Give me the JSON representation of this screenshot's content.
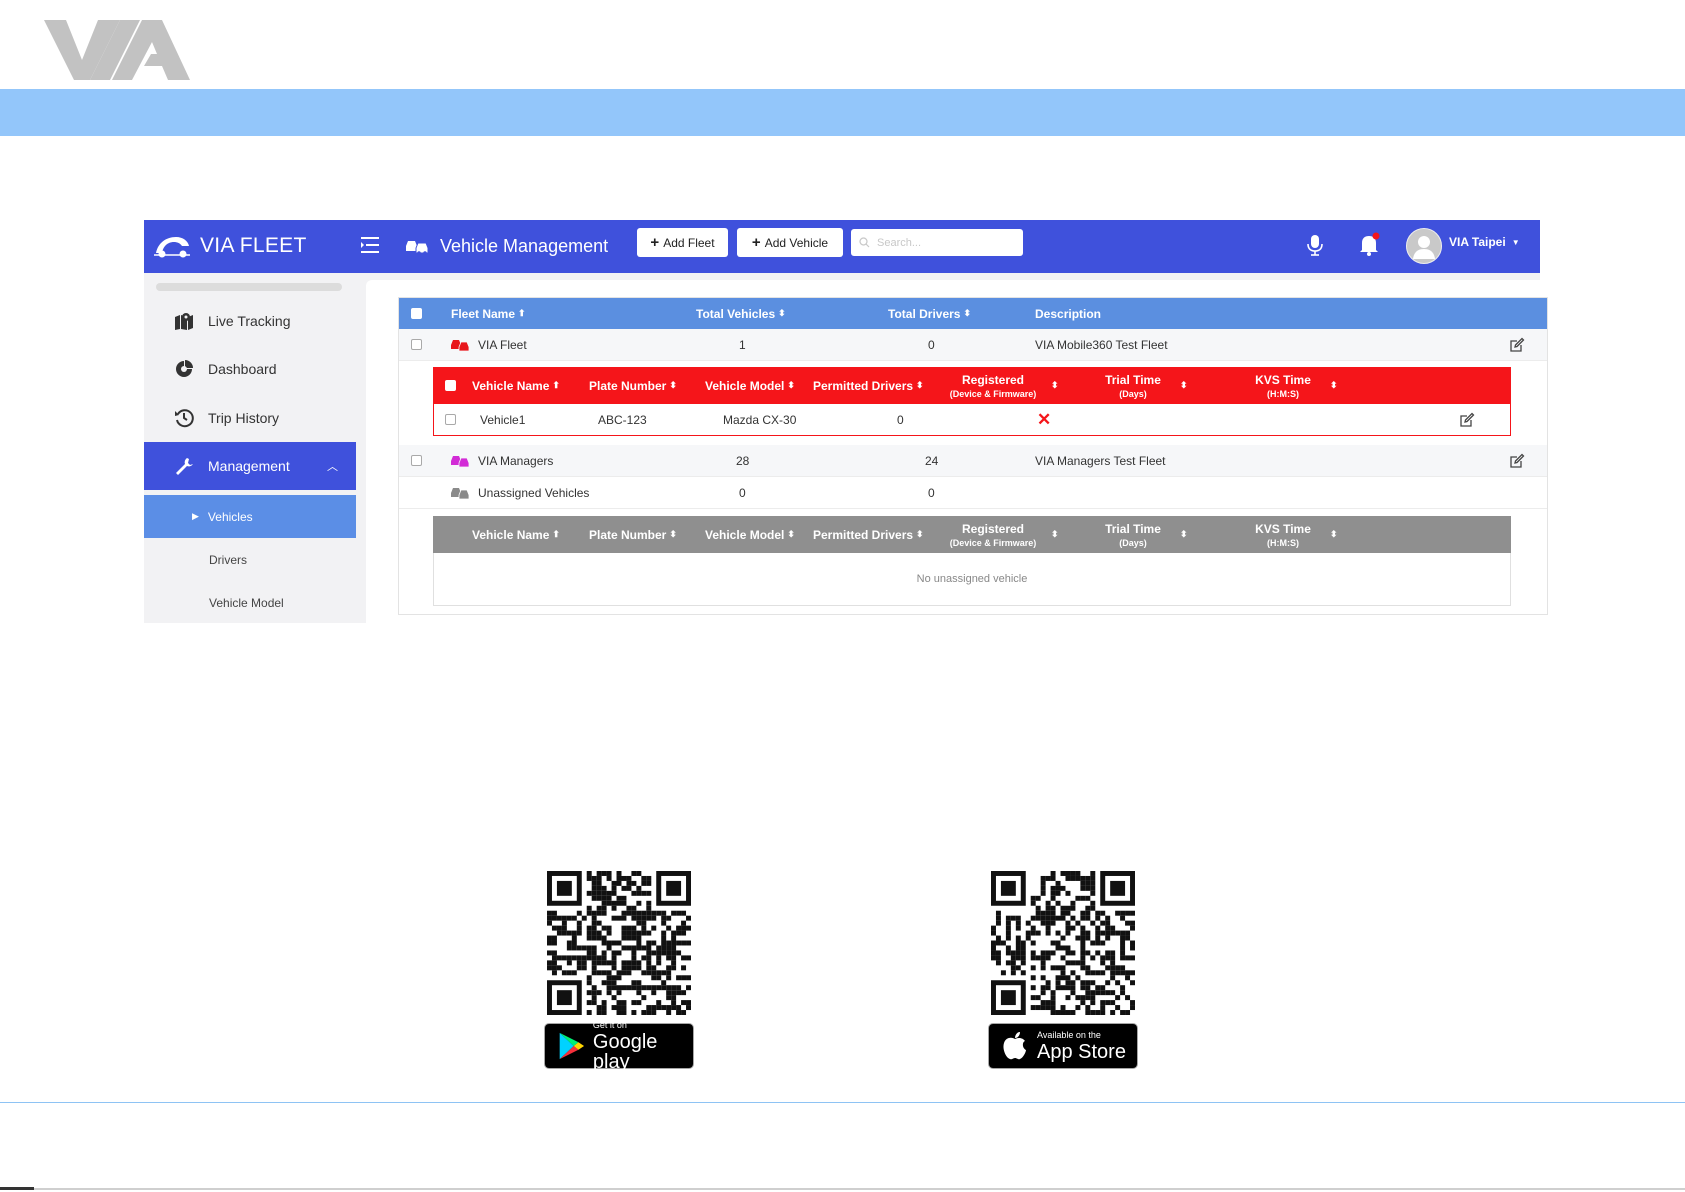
{
  "app": {
    "brand": "VIA FLEET",
    "page_title": "Vehicle Management",
    "add_fleet": "Add Fleet",
    "add_vehicle": "Add Vehicle",
    "search_placeholder": "Search...",
    "user": "VIA Taipei"
  },
  "sidebar": {
    "items": [
      {
        "label": "Live Tracking"
      },
      {
        "label": "Dashboard"
      },
      {
        "label": "Trip History"
      },
      {
        "label": "Management"
      }
    ],
    "sub_items": [
      {
        "label": "Vehicles"
      },
      {
        "label": "Drivers"
      },
      {
        "label": "Vehicle Model"
      }
    ]
  },
  "fleet_table": {
    "columns": [
      "Fleet Name",
      "Total Vehicles",
      "Total Drivers",
      "Description"
    ],
    "rows": [
      {
        "name": "VIA Fleet",
        "vehicles": "1",
        "drivers": "0",
        "description": "VIA Mobile360 Test Fleet"
      },
      {
        "name": "VIA Managers",
        "vehicles": "28",
        "drivers": "24",
        "description": "VIA Managers Test Fleet"
      },
      {
        "name": "Unassigned Vehicles",
        "vehicles": "0",
        "drivers": "0",
        "description": ""
      }
    ]
  },
  "vehicle_table": {
    "columns": {
      "name": "Vehicle Name",
      "plate": "Plate Number",
      "model": "Vehicle Model",
      "permitted": "Permitted Drivers",
      "registered": "Registered",
      "registered_sub": "(Device & Firmware)",
      "trial": "Trial Time",
      "trial_sub": "(Days)",
      "kvs": "KVS Time",
      "kvs_sub": "(H:M:S)"
    },
    "rows": [
      {
        "name": "Vehicle1",
        "plate": "ABC-123",
        "model": "Mazda CX-30",
        "permitted": "0",
        "registered": "✕"
      }
    ],
    "empty_text": "No unassigned vehicle"
  },
  "downloads": {
    "google": {
      "small": "Get it on",
      "big": "Google play"
    },
    "apple": {
      "small": "Available on the",
      "big": "App Store"
    }
  },
  "colors": {
    "topbar": "#3f51dc",
    "band": "#93c6fa",
    "fleet_header": "#5b8fe0",
    "vehicle_header": "#f5151a",
    "unassigned_header": "#8f8f8f"
  }
}
